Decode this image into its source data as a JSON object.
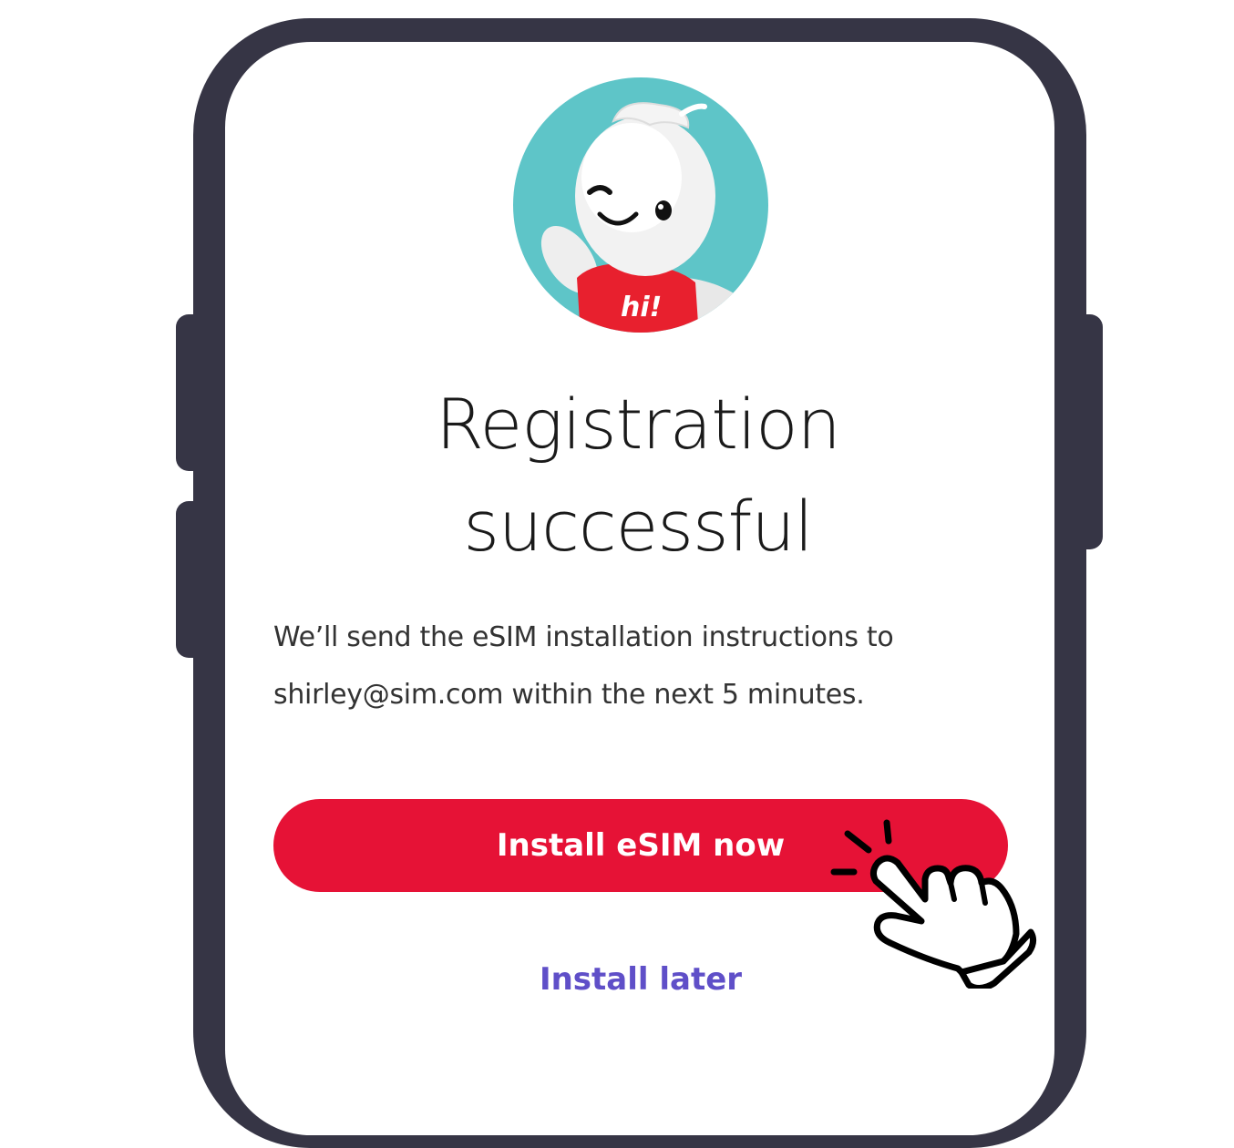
{
  "screen": {
    "title_line1": "Registration",
    "title_line2": "successful",
    "message_line1": "We’ll send the eSIM installation instructions to",
    "message_line2": "shirley@sim.com within the next 5 minutes.",
    "primary_button_label": "Install eSIM now",
    "secondary_button_label": "Install later"
  },
  "mascot": {
    "shirt_text": "hi!",
    "icon": "mascot-avatar"
  },
  "colors": {
    "phone_frame": "#363545",
    "avatar_bg": "#5ec5c8",
    "primary": "#e61236",
    "link": "#5f4fc8"
  },
  "overlay": {
    "icon": "tap-hand-icon"
  }
}
